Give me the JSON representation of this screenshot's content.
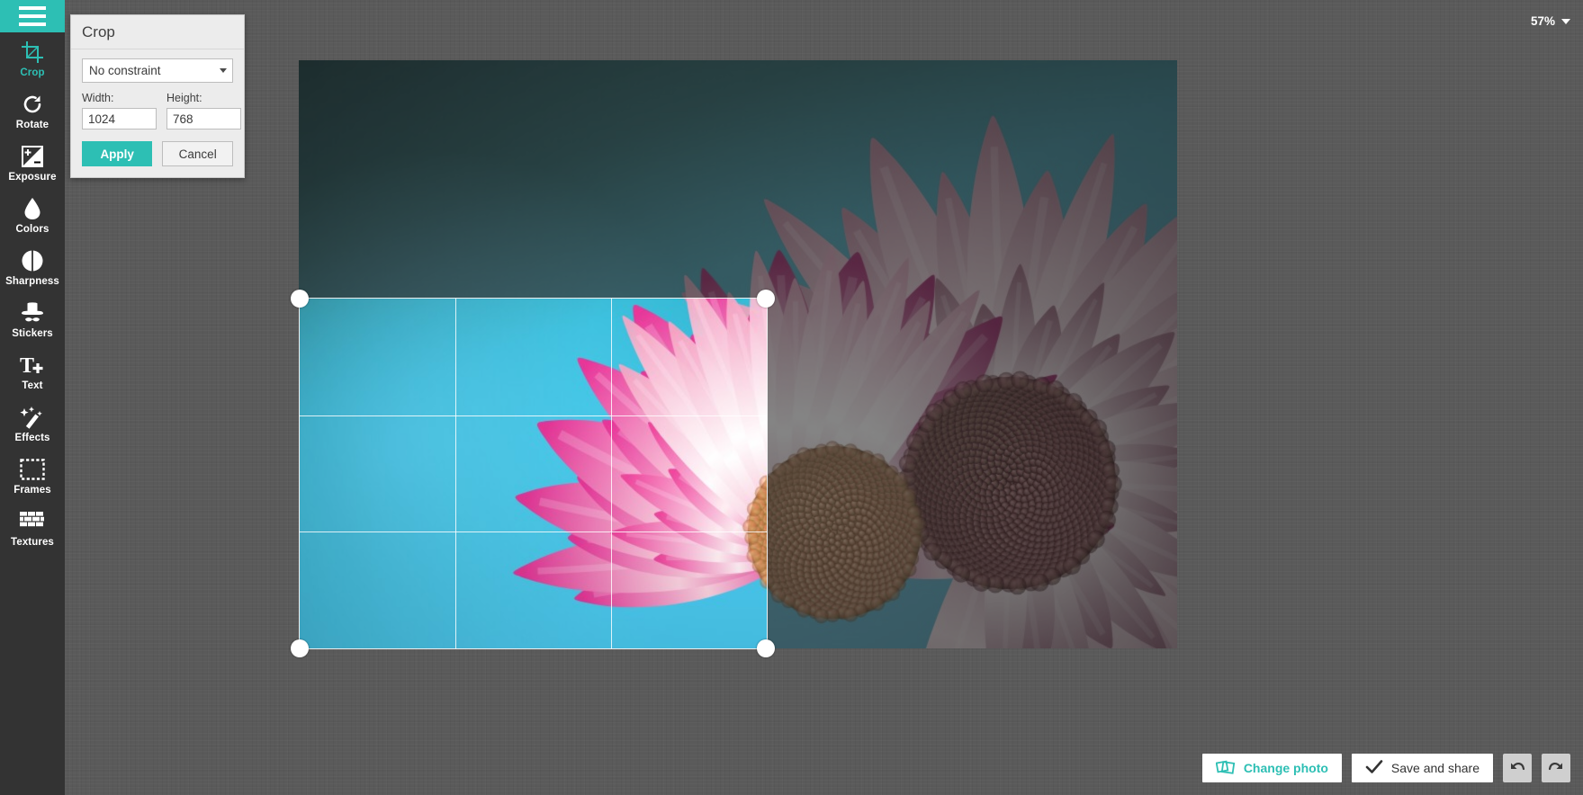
{
  "app": {
    "menu_icon": "hamburger-menu-icon",
    "background_color": "#5a5a5a",
    "accent_color": "#2dbfb4"
  },
  "sidebar": {
    "items": [
      {
        "label": "Crop",
        "icon": "crop-icon",
        "active": true
      },
      {
        "label": "Rotate",
        "icon": "rotate-icon",
        "active": false
      },
      {
        "label": "Exposure",
        "icon": "exposure-icon",
        "active": false
      },
      {
        "label": "Colors",
        "icon": "droplet-icon",
        "active": false
      },
      {
        "label": "Sharpness",
        "icon": "contrast-circle-icon",
        "active": false
      },
      {
        "label": "Stickers",
        "icon": "hat-mustache-icon",
        "active": false
      },
      {
        "label": "Text",
        "icon": "text-plus-icon",
        "active": false
      },
      {
        "label": "Effects",
        "icon": "magic-wand-icon",
        "active": false
      },
      {
        "label": "Frames",
        "icon": "frame-icon",
        "active": false
      },
      {
        "label": "Textures",
        "icon": "brick-wall-icon",
        "active": false
      }
    ]
  },
  "crop_panel": {
    "title": "Crop",
    "constraint_value": "No constraint",
    "constraint_caret_icon": "chevron-down-icon",
    "width_label": "Width:",
    "width_value": "1024",
    "height_label": "Height:",
    "height_value": "768",
    "apply_label": "Apply",
    "cancel_label": "Cancel"
  },
  "zoom": {
    "level": "57%",
    "caret_icon": "chevron-down-icon"
  },
  "bottom_bar": {
    "change_photo_label": "Change photo",
    "change_photo_icon": "photos-stack-icon",
    "save_share_label": "Save and share",
    "save_share_icon": "checkmark-icon",
    "undo_icon": "undo-arrow-icon",
    "redo_icon": "redo-arrow-icon"
  },
  "canvas": {
    "crop_overlay_grid": "rule-of-thirds",
    "handles": [
      "top-left",
      "top-right",
      "bottom-left",
      "bottom-right"
    ]
  }
}
